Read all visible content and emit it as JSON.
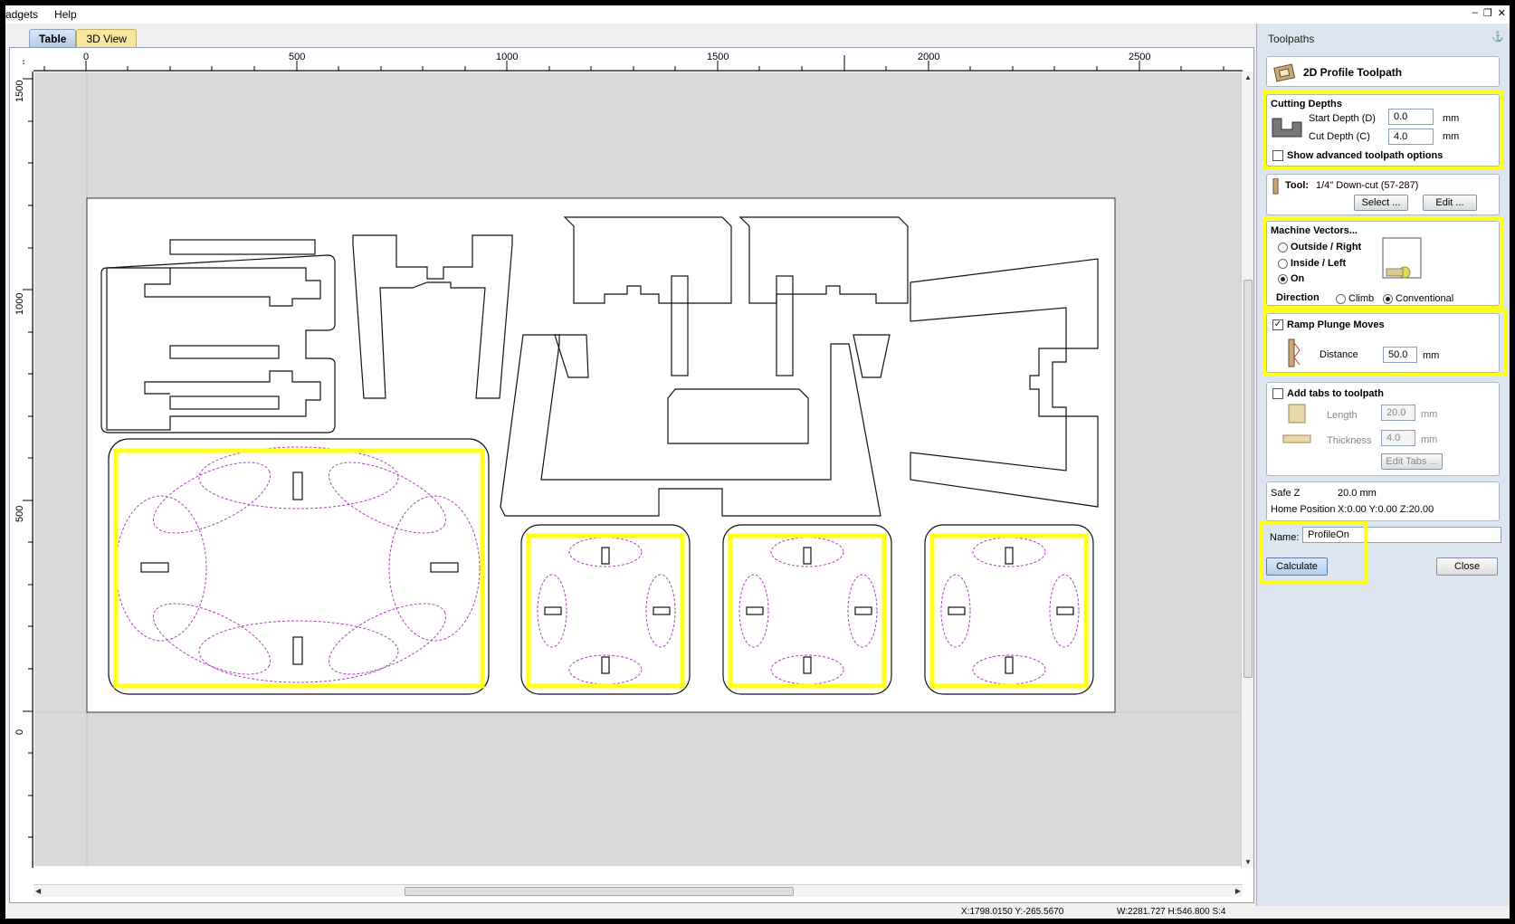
{
  "menu": [
    "adgets",
    "Help"
  ],
  "window_controls": [
    "–",
    "❐",
    "✕"
  ],
  "tabs": {
    "table": "Table",
    "view3d": "3D View"
  },
  "ruler": {
    "corner": "↕",
    "top_labels": [
      "0",
      "500",
      "1000",
      "1500",
      "2000",
      "2500"
    ],
    "left_labels": [
      "1500",
      "1000",
      "500",
      "0"
    ]
  },
  "status": {
    "cursor": "X:1798.0150 Y:-265.5670",
    "size": "W:2281.727   H:546.800  S:4"
  },
  "panel": {
    "title": "Toolpaths",
    "pin": "⚓",
    "header": "2D Profile Toolpath",
    "cutting": {
      "title": "Cutting Depths",
      "start_label": "Start Depth (D)",
      "start_value": "0.0",
      "cut_label": "Cut Depth (C)",
      "cut_value": "4.0",
      "unit": "mm",
      "advanced": "Show advanced toolpath options"
    },
    "tool": {
      "label": "Tool:",
      "value": "1/4\" Down-cut (57-287)",
      "select": "Select ...",
      "edit": "Edit ..."
    },
    "machine": {
      "title": "Machine Vectors...",
      "outside": "Outside / Right",
      "inside": "Inside / Left",
      "on": "On",
      "direction": "Direction",
      "climb": "Climb",
      "conventional": "Conventional"
    },
    "ramp": {
      "label": "Ramp Plunge Moves",
      "distance_label": "Distance",
      "distance_value": "50.0",
      "unit": "mm"
    },
    "tabs": {
      "label": "Add tabs to toolpath",
      "length_label": "Length",
      "length_value": "20.0",
      "thickness_label": "Thickness",
      "thickness_value": "4.0",
      "unit": "mm",
      "edit": "Edit Tabs ..."
    },
    "safe_z": {
      "label": "Safe Z",
      "value": "20.0 mm"
    },
    "home": {
      "label": "Home Position",
      "value": "X:0.00 Y:0.00 Z:20.00"
    },
    "name": {
      "label": "Name:",
      "value": "ProfileOn"
    },
    "calculate": "Calculate",
    "close": "Close"
  },
  "colors": {
    "highlight": "#ffff1a",
    "toolpath": "#b040c0",
    "sheet": "#ffffff",
    "canvas_bg": "#d9d9d9"
  }
}
